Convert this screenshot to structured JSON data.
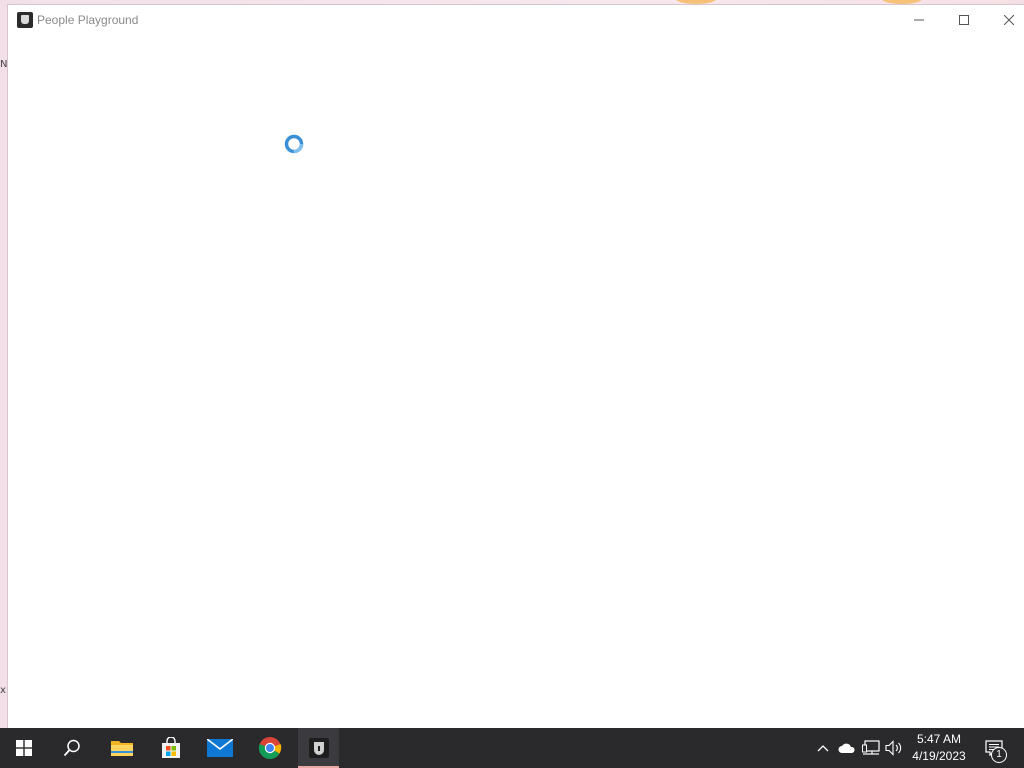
{
  "window": {
    "title": "People Playground",
    "controls": {
      "minimize_icon": "minimize-icon",
      "maximize_icon": "maximize-icon",
      "close_icon": "close-icon"
    },
    "state": "loading",
    "spinner_color": "#3a8fd6"
  },
  "taskbar": {
    "pinned": [
      {
        "name": "start",
        "icon": "windows-logo-icon"
      },
      {
        "name": "search",
        "icon": "search-icon"
      },
      {
        "name": "file-explorer",
        "icon": "folder-icon"
      },
      {
        "name": "microsoft-store",
        "icon": "store-icon"
      },
      {
        "name": "mail",
        "icon": "mail-icon"
      },
      {
        "name": "chrome",
        "icon": "chrome-icon"
      },
      {
        "name": "people-playground",
        "icon": "people-playground-icon",
        "active": true
      }
    ],
    "tray": {
      "time": "5:47 AM",
      "date": "4/19/2023",
      "notification_count": "1"
    },
    "background": "#2a2a2d"
  },
  "desktop": {
    "edge_text_top": "N",
    "edge_text_bottom": "x"
  }
}
